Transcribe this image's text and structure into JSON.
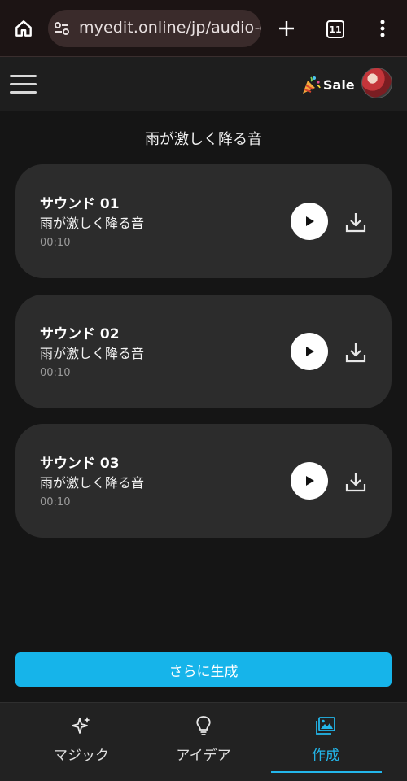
{
  "browser": {
    "url": "myedit.online/jp/audio-ed",
    "tab_count": "11"
  },
  "header": {
    "sale_label": "Sale"
  },
  "page": {
    "title": "雨が激しく降る音"
  },
  "sounds": [
    {
      "title": "サウンド 01",
      "description": "雨が激しく降る音",
      "duration": "00:10"
    },
    {
      "title": "サウンド 02",
      "description": "雨が激しく降る音",
      "duration": "00:10"
    },
    {
      "title": "サウンド 03",
      "description": "雨が激しく降る音",
      "duration": "00:10"
    }
  ],
  "generate_more_label": "さらに生成",
  "bottom_nav": [
    {
      "label": "マジック",
      "icon": "sparkles-icon"
    },
    {
      "label": "アイデア",
      "icon": "lightbulb-icon"
    },
    {
      "label": "作成",
      "icon": "image-gallery-icon",
      "active": true
    }
  ],
  "colors": {
    "accent": "#16b4ea",
    "card": "#2c2c2c",
    "background": "#151515"
  }
}
